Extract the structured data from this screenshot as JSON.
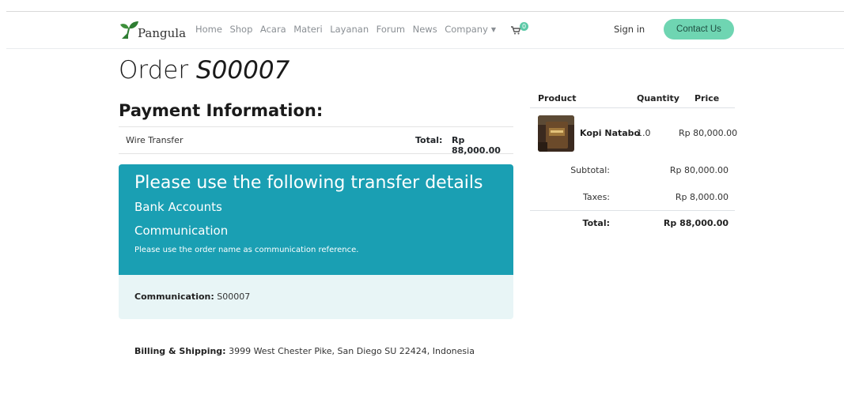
{
  "navbar": {
    "brand": "Pangula",
    "links": [
      "Home",
      "Shop",
      "Acara",
      "Materi",
      "Layanan",
      "Forum",
      "News"
    ],
    "company_label": "Company",
    "cart_count": "0",
    "signin_label": "Sign in",
    "contact_label": "Contact Us"
  },
  "order": {
    "prefix": "Order",
    "number": "S00007"
  },
  "payment": {
    "title": "Payment Information:",
    "method": "Wire Transfer",
    "total_label": "Total:",
    "total_value": "Rp 88,000.00"
  },
  "transfer": {
    "heading": "Please use the following transfer details",
    "bank_accounts": "Bank Accounts",
    "communication_heading": "Communication",
    "note": "Please use the order name as communication reference.",
    "communication_label": "Communication:",
    "communication_value": "S00007"
  },
  "billing": {
    "label": "Billing & Shipping:",
    "address": "3999 West Chester Pike, San Diego SU 22424, Indonesia"
  },
  "summary": {
    "headers": {
      "product": "Product",
      "quantity": "Quantity",
      "price": "Price"
    },
    "item": {
      "name": "Kopi Natabo",
      "qty": "1.0",
      "price": "Rp 80,000.00"
    },
    "subtotal_label": "Subtotal:",
    "subtotal_value": "Rp 80,000.00",
    "taxes_label": "Taxes:",
    "taxes_value": "Rp 8,000.00",
    "total_label": "Total:",
    "total_value": "Rp 88,000.00"
  },
  "colors": {
    "accent": "#6fd5b2",
    "card_header": "#1a9fb3",
    "card_footer": "#e8f5f6"
  }
}
